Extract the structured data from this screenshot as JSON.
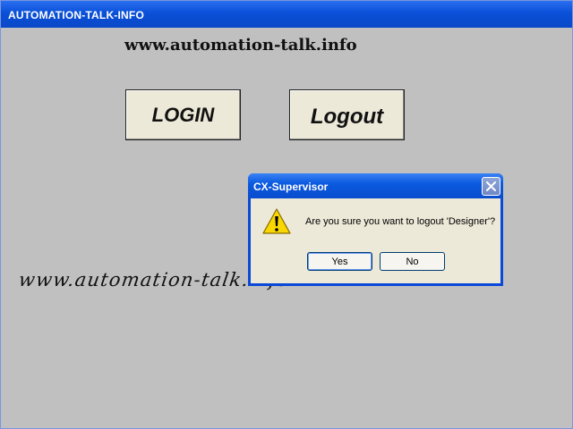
{
  "window": {
    "title": "AUTOMATION-TALK-INFO"
  },
  "main": {
    "site_url": "www.automation-talk.info",
    "login_label": "LOGIN",
    "logout_label": "Logout",
    "watermark": "www.automation-talk.info"
  },
  "dialog": {
    "title": "CX-Supervisor",
    "message": "Are you sure you want to logout 'Designer'?",
    "yes_label": "Yes",
    "no_label": "No",
    "icon": "warning-icon"
  },
  "colors": {
    "titlebar": "#0a50d8",
    "background": "#c0c0c0",
    "button_face": "#ece9d8",
    "dialog_border": "#0a48d8"
  }
}
